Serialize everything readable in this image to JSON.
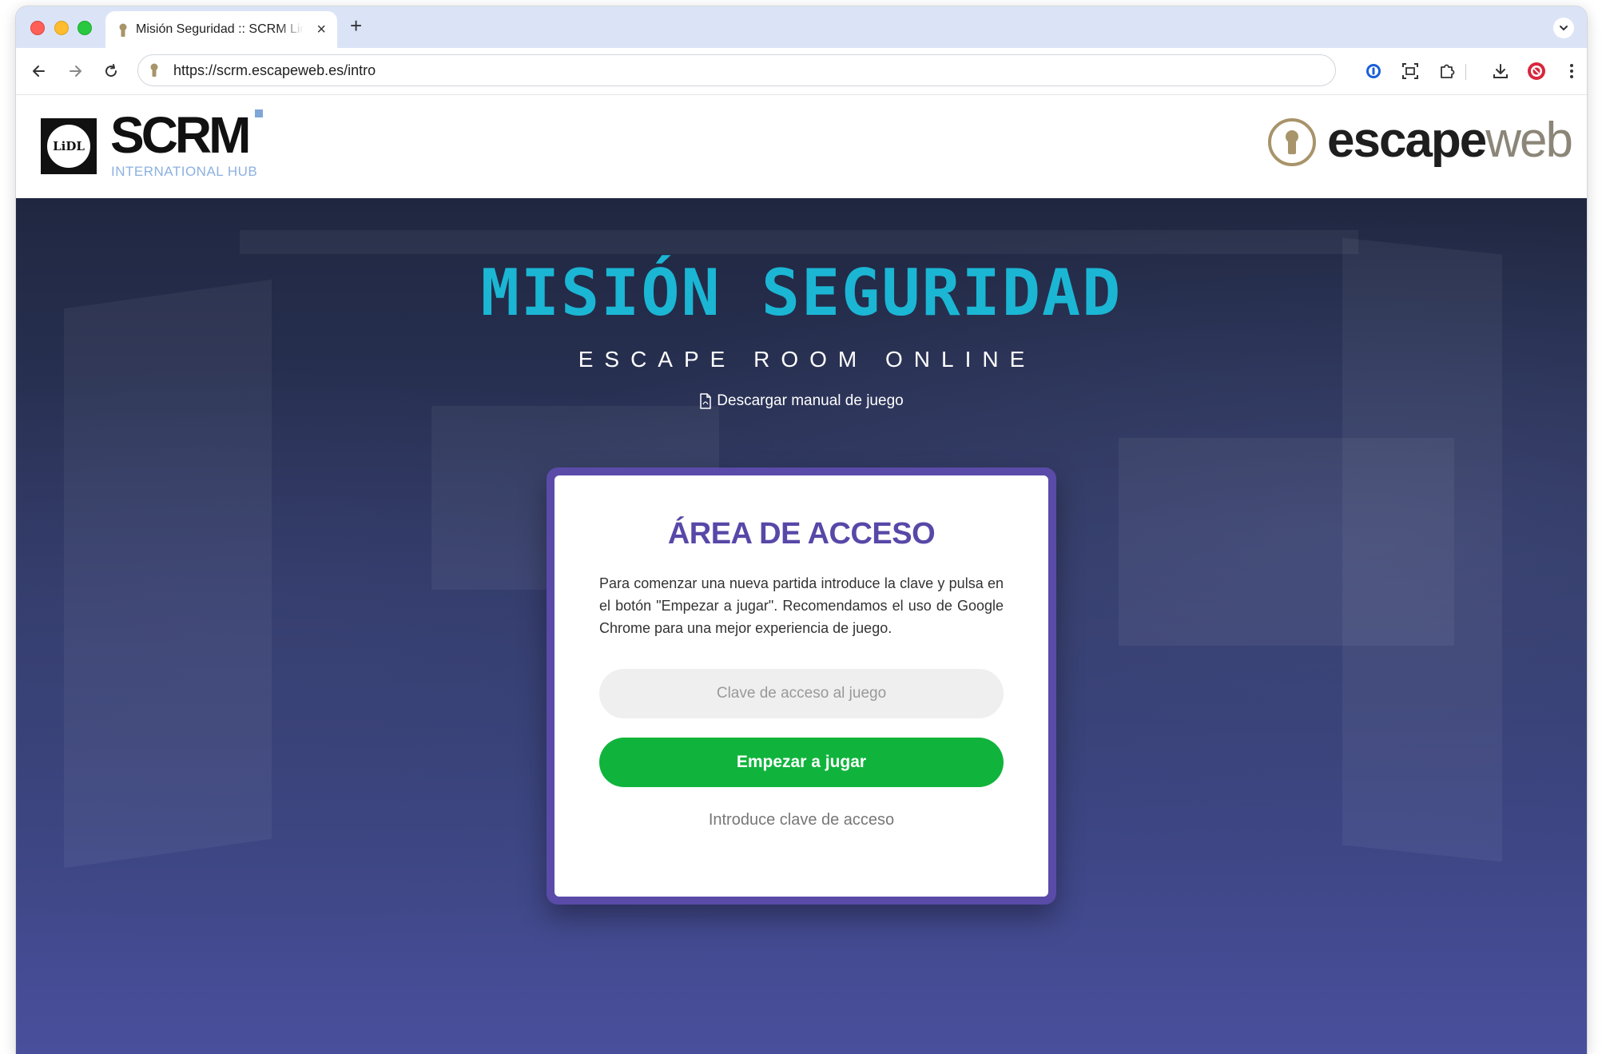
{
  "browser": {
    "tab_title": "Misión Seguridad :: SCRM Lidl",
    "tab_close": "×",
    "new_tab": "+",
    "url": "https://scrm.escapeweb.es/intro"
  },
  "header": {
    "lidl_logo_text": "LiDL",
    "scrm_word": "SCRM",
    "scrm_subtitle": "INTERNATIONAL HUB",
    "escapeweb_dark": "escape",
    "escapeweb_light": "web"
  },
  "hero": {
    "title": "MISIÓN SEGURIDAD",
    "subtitle": "ESCAPE ROOM ONLINE",
    "manual_link": "Descargar manual de juego"
  },
  "login": {
    "title": "ÁREA DE ACCESO",
    "description": "Para comenzar una nueva partida introduce la clave y pulsa en el botón \"Empezar a jugar\". Recomendamos el uso de Google Chrome para una mejor experiencia de juego.",
    "input_placeholder": "Clave de acceso al juego",
    "button_label": "Empezar a jugar",
    "status": "Introduce clave de acceso"
  },
  "colors": {
    "title_cyan": "#1bb6d4",
    "card_border": "#5a4ba8",
    "card_title": "#5748a8",
    "button_green": "#10b43c",
    "tab_strip": "#dbe4f7"
  },
  "icons": {
    "back": "arrow-left-icon",
    "forward": "arrow-right-icon",
    "reload": "reload-icon",
    "site_info": "keyhole-icon",
    "password_manager": "password-manager-icon",
    "screenshot": "screenshot-icon",
    "extensions": "puzzle-icon",
    "download": "download-icon",
    "profile": "profile-icon",
    "menu": "kebab-menu-icon",
    "manual": "pdf-file-icon"
  }
}
